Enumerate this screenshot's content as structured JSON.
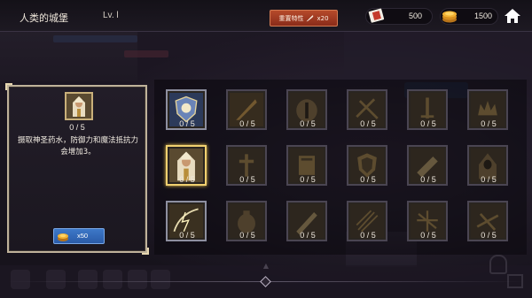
{
  "header": {
    "title": "人类的城堡",
    "level": "Lv. l",
    "reset_label": "重置特性",
    "reset_cost": "x20",
    "resources": [
      {
        "name": "ticket",
        "value": "500"
      },
      {
        "name": "gold",
        "value": "1500"
      }
    ]
  },
  "selected_trait": {
    "progress": "0 / 5",
    "description": "摄取神圣药水，防御力和魔法抵抗力会增加3。",
    "upgrade_cost": "x50"
  },
  "traits": [
    {
      "icon": "lion-shield-icon",
      "progress": "0 / 5",
      "state": "active"
    },
    {
      "icon": "feather-icon",
      "progress": "0 / 5",
      "state": "locked"
    },
    {
      "icon": "helmet-icon",
      "progress": "0 / 5",
      "state": "locked"
    },
    {
      "icon": "crossed-swords-icon",
      "progress": "0 / 5",
      "state": "locked"
    },
    {
      "icon": "sword-icon",
      "progress": "0 / 5",
      "state": "locked"
    },
    {
      "icon": "crown-icon",
      "progress": "0 / 5",
      "state": "locked"
    },
    {
      "icon": "priest-icon",
      "progress": "0 / 5",
      "state": "selected"
    },
    {
      "icon": "cross-icon",
      "progress": "0 / 5",
      "state": "locked"
    },
    {
      "icon": "tome-icon",
      "progress": "0 / 5",
      "state": "locked"
    },
    {
      "icon": "shield-icon",
      "progress": "0 / 5",
      "state": "locked"
    },
    {
      "icon": "scroll-icon",
      "progress": "0 / 5",
      "state": "locked"
    },
    {
      "icon": "hooded-figure-icon",
      "progress": "0 / 5",
      "state": "locked"
    },
    {
      "icon": "lightning-bow-icon",
      "progress": "0 / 5",
      "state": "active"
    },
    {
      "icon": "beetle-icon",
      "progress": "0 / 5",
      "state": "locked"
    },
    {
      "icon": "greatsword-icon",
      "progress": "0 / 5",
      "state": "locked"
    },
    {
      "icon": "arrows-icon",
      "progress": "0 / 5",
      "state": "locked"
    },
    {
      "icon": "crossbow-icon",
      "progress": "0 / 5",
      "state": "locked"
    },
    {
      "icon": "sword-burst-icon",
      "progress": "0 / 5",
      "state": "locked"
    }
  ],
  "colors": {
    "selected_border": "#f0d070",
    "reset_button": "#a63f22",
    "cost_button": "#3368b8"
  }
}
